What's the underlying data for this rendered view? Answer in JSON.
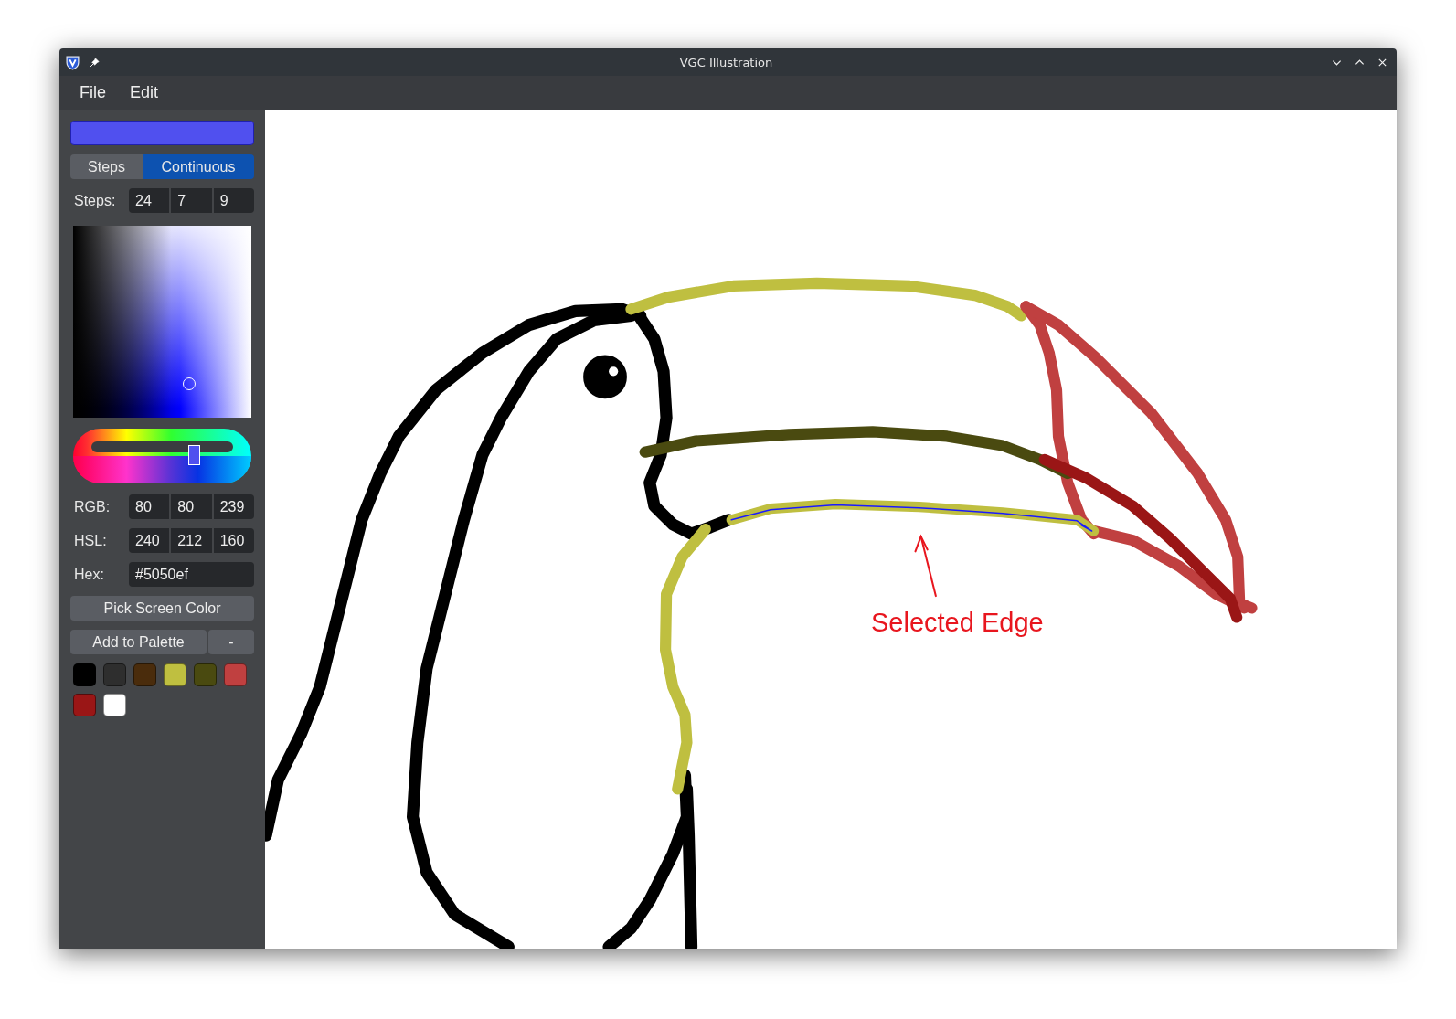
{
  "window": {
    "title": "VGC Illustration"
  },
  "menu": [
    "File",
    "Edit"
  ],
  "color_panel": {
    "current_color": {
      "color": "#5050ef"
    },
    "modes": [
      {
        "label": "Steps",
        "selected": false
      },
      {
        "label": "Continuous",
        "selected": true
      }
    ],
    "steps": {
      "label": "Steps:",
      "values": [
        "24",
        "7",
        "9"
      ]
    },
    "hue_slider": {
      "level": 0.72
    },
    "rgb": {
      "label": "RGB:",
      "values": [
        "80",
        "80",
        "239"
      ]
    },
    "hsl": {
      "label": "HSL:",
      "values": [
        "240",
        "212",
        "160"
      ]
    },
    "hex": {
      "label": "Hex:",
      "value": "#5050ef"
    },
    "pick_button": "Pick Screen Color",
    "add_button": "Add to Palette",
    "remove_button": "-",
    "palette": [
      {
        "color": "#000000"
      },
      {
        "color": "#2e2e2e"
      },
      {
        "color": "#4a2c0c"
      },
      {
        "color": "#bfbf40"
      },
      {
        "color": "#4a4a10"
      },
      {
        "color": "#c04040"
      },
      {
        "color": "#9a1616"
      },
      {
        "color": "#ffffff"
      }
    ]
  },
  "canvas": {
    "annotation": "Selected Edge"
  }
}
